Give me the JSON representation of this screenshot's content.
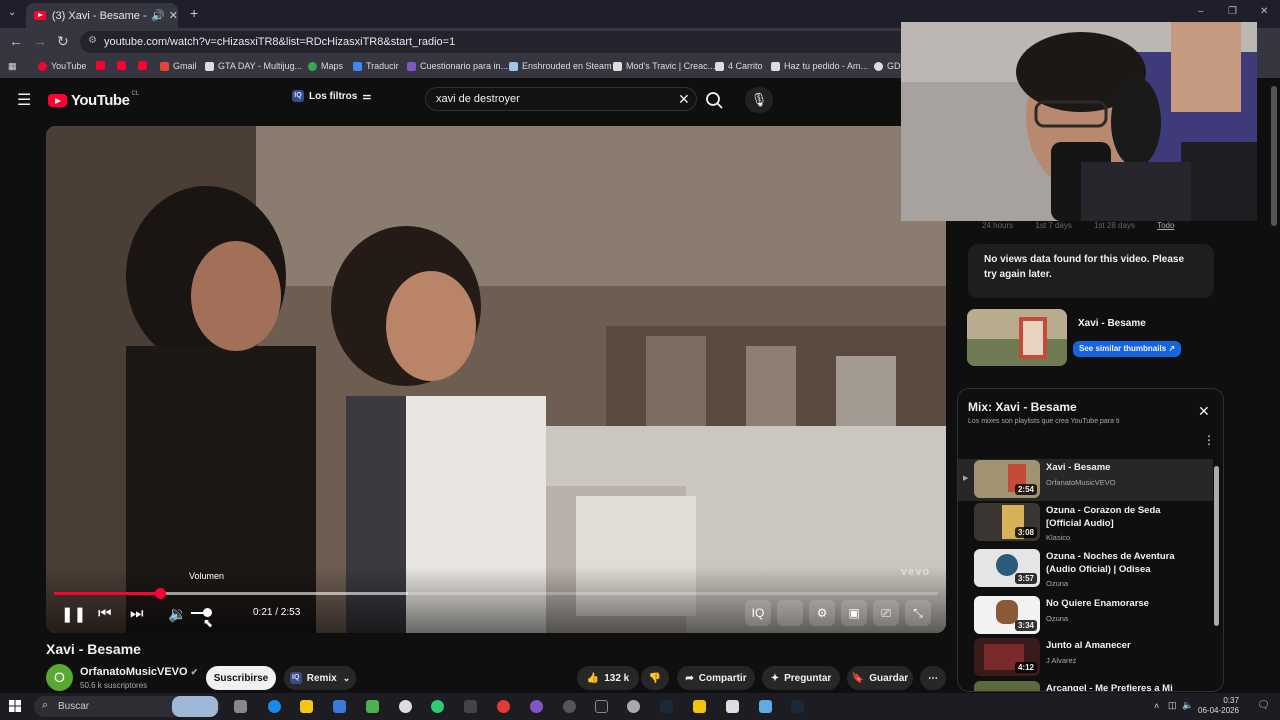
{
  "browser": {
    "tab_title": "(3) Xavi - Besame - YouTube",
    "url": "youtube.com/watch?v=cHizasxiTR8&list=RDcHizasxiTR8&start_radio=1",
    "bookmarks": [
      {
        "label": "YouTube",
        "color": "#ff0033"
      },
      {
        "label": "",
        "color": "#ff0033"
      },
      {
        "label": "",
        "color": "#ff0033"
      },
      {
        "label": "Gmail",
        "color": "#ea4335"
      },
      {
        "label": "GTA DAY - Multijug...",
        "color": "#dddddd"
      },
      {
        "label": "Maps",
        "color": "#34a853"
      },
      {
        "label": "Traducir",
        "color": "#4285f4"
      },
      {
        "label": "Cuestionario para in...",
        "color": "#7e57c2"
      },
      {
        "label": "Enshrouded en Steam",
        "color": "#9fc4e8"
      },
      {
        "label": "Mod's Travic | Creac...",
        "color": "#dddddd"
      },
      {
        "label": "4 Carrito",
        "color": "#dddddd"
      },
      {
        "label": "Haz tu pedido - Am...",
        "color": "#dddddd"
      },
      {
        "label": "GDC",
        "color": "#dddddd"
      }
    ]
  },
  "youtube": {
    "logo_text": "YouTube",
    "country": "CL",
    "filters_label": "Los filtros",
    "search_value": "xavi de destroyer"
  },
  "player": {
    "volume_tooltip": "Volumen",
    "time": "0:21 / 2:53",
    "progress_fraction": 0.12,
    "buffered_fraction": 0.4,
    "watermark": "vevo"
  },
  "video": {
    "title": "Xavi - Besame",
    "channel": "OrfanatoMusicVEVO",
    "avatar_letter": "O",
    "subscribers": "50.6 k suscriptores",
    "subscribe_label": "Suscribirse",
    "remix_label": "Remix",
    "likes": "132 k",
    "share_label": "Compartir",
    "ask_label": "Preguntar",
    "save_label": "Guardar"
  },
  "views_panel": {
    "tabs": [
      "24 hours",
      "1st 7 days",
      "1st 28 days",
      "Todo"
    ],
    "message": "No views data found for this video. Please try again later.",
    "thumb_title": "Xavi - Besame",
    "similar_label": "See similar thumbnails"
  },
  "playlist": {
    "title": "Mix: Xavi - Besame",
    "subtitle": "Los mixes son playlists que crea YouTube para ti",
    "items": [
      {
        "title": "Xavi - Besame",
        "channel": "OrfanatoMusicVEVO",
        "duration": "2:54"
      },
      {
        "title": "Ozuna - Corazon de Seda [Official Audio]",
        "channel": "Klasico",
        "duration": "3:08"
      },
      {
        "title": "Ozuna - Noches de Aventura (Audio Oficial) | Odisea",
        "channel": "Ozuna",
        "duration": "3:57"
      },
      {
        "title": "No Quiere Enamorarse",
        "channel": "Ozuna",
        "duration": "3:34"
      },
      {
        "title": "Junto al Amanecer",
        "channel": "J Alvarez",
        "duration": "4:12"
      },
      {
        "title": "Arcangel - Me Prefieres a Mi",
        "channel": "",
        "duration": ""
      }
    ]
  },
  "taskbar": {
    "search_placeholder": "Buscar",
    "time": "0:37",
    "date": "06-04-2026"
  }
}
